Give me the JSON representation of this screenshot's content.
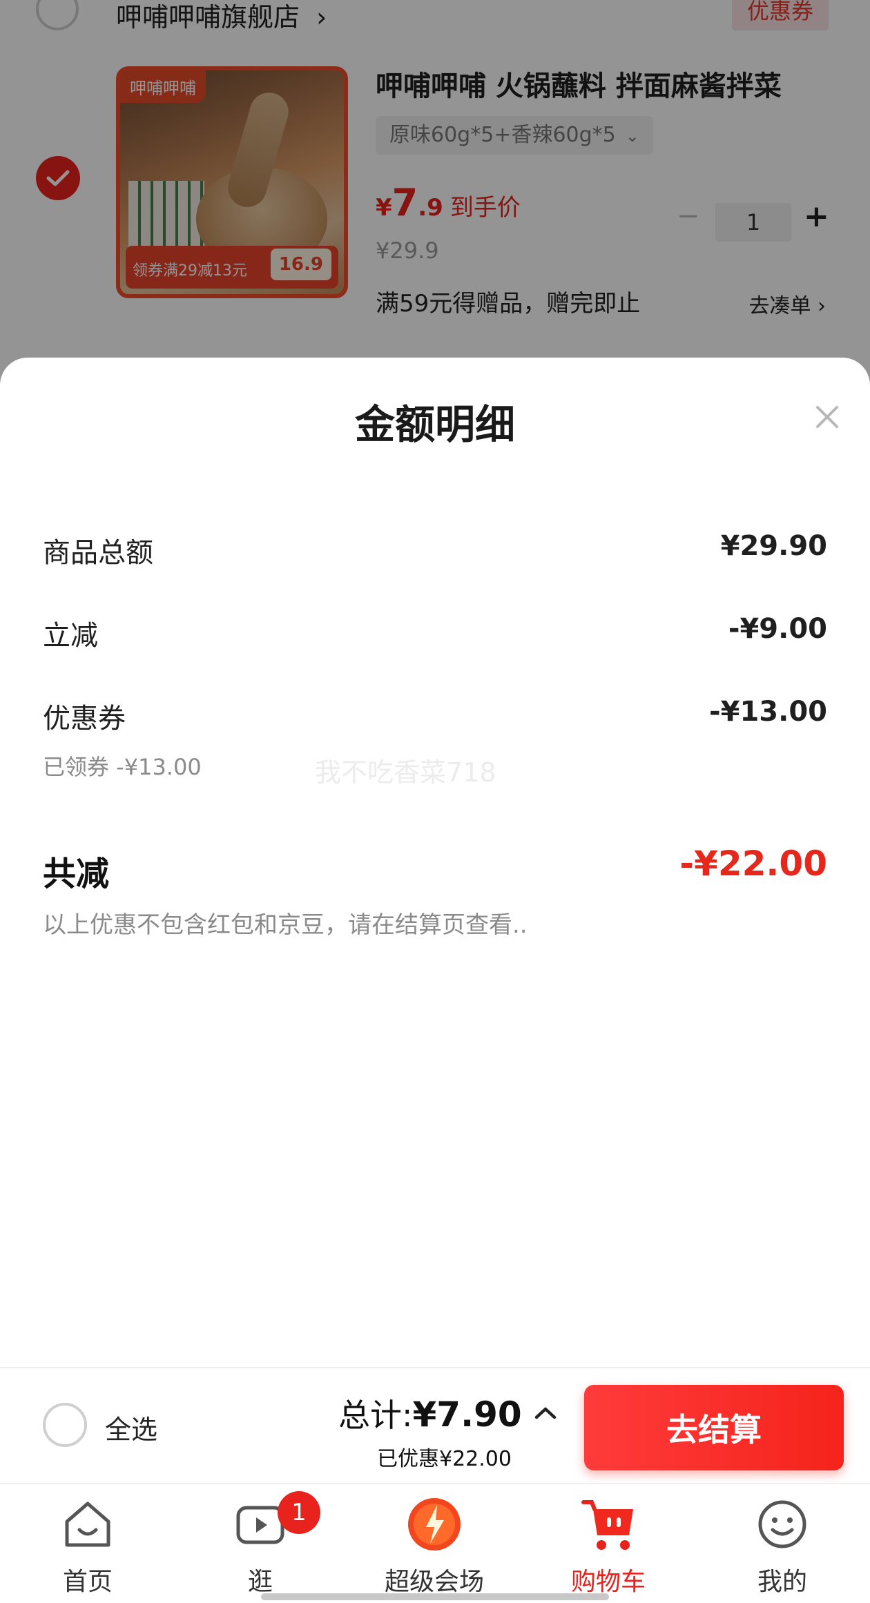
{
  "store": {
    "name": "呷哺呷哺旗舰店",
    "name_chevron": "›",
    "coupon_label": "优惠券"
  },
  "product": {
    "title": "呷哺呷哺 火锅蘸料 拌面麻酱拌菜",
    "spec": "原味60g*5+香辣60g*5",
    "spec_chevron": "⌄",
    "price_currency": "¥",
    "price_integer": "7",
    "price_decimal": ".9",
    "price_label": "到手价",
    "original_price": "¥29.9",
    "promo": "满59元得赠品，赠完即止",
    "goto_label": "去凑单",
    "goto_chevron": "›",
    "quantity": "1",
    "minus": "−",
    "plus": "+",
    "image_brand": "呷哺呷哺",
    "image_banner": "领券满29减13元",
    "image_price": "16.9"
  },
  "sheet": {
    "title": "金额明细",
    "rows": [
      {
        "label": "商品总额",
        "value": "¥29.90"
      },
      {
        "label": "立减",
        "value": "-¥9.00"
      },
      {
        "label": "优惠券",
        "value": "-¥13.00",
        "sub": "已领券 -¥13.00"
      }
    ],
    "watermark": "我不吃香菜718",
    "total_label": "共减",
    "total_value": "-¥22.00",
    "note": "以上优惠不包含红包和京豆，请在结算页查看.."
  },
  "checkout": {
    "select_all": "全选",
    "sum_label": "总计:",
    "sum_value": "¥7.90",
    "saved": "已优惠¥22.00",
    "button": "去结算"
  },
  "tabs": [
    {
      "label": "首页",
      "icon": "home-icon"
    },
    {
      "label": "逛",
      "icon": "video-icon",
      "badge": "1"
    },
    {
      "label": "超级会场",
      "icon": "super-venue-icon"
    },
    {
      "label": "购物车",
      "icon": "cart-icon",
      "active": true
    },
    {
      "label": "我的",
      "icon": "profile-icon"
    }
  ],
  "colors": {
    "accent": "#e8231d",
    "total_red": "#e6281c",
    "button_gradient_start": "#ff3b3b",
    "button_gradient_end": "#f5231b"
  }
}
